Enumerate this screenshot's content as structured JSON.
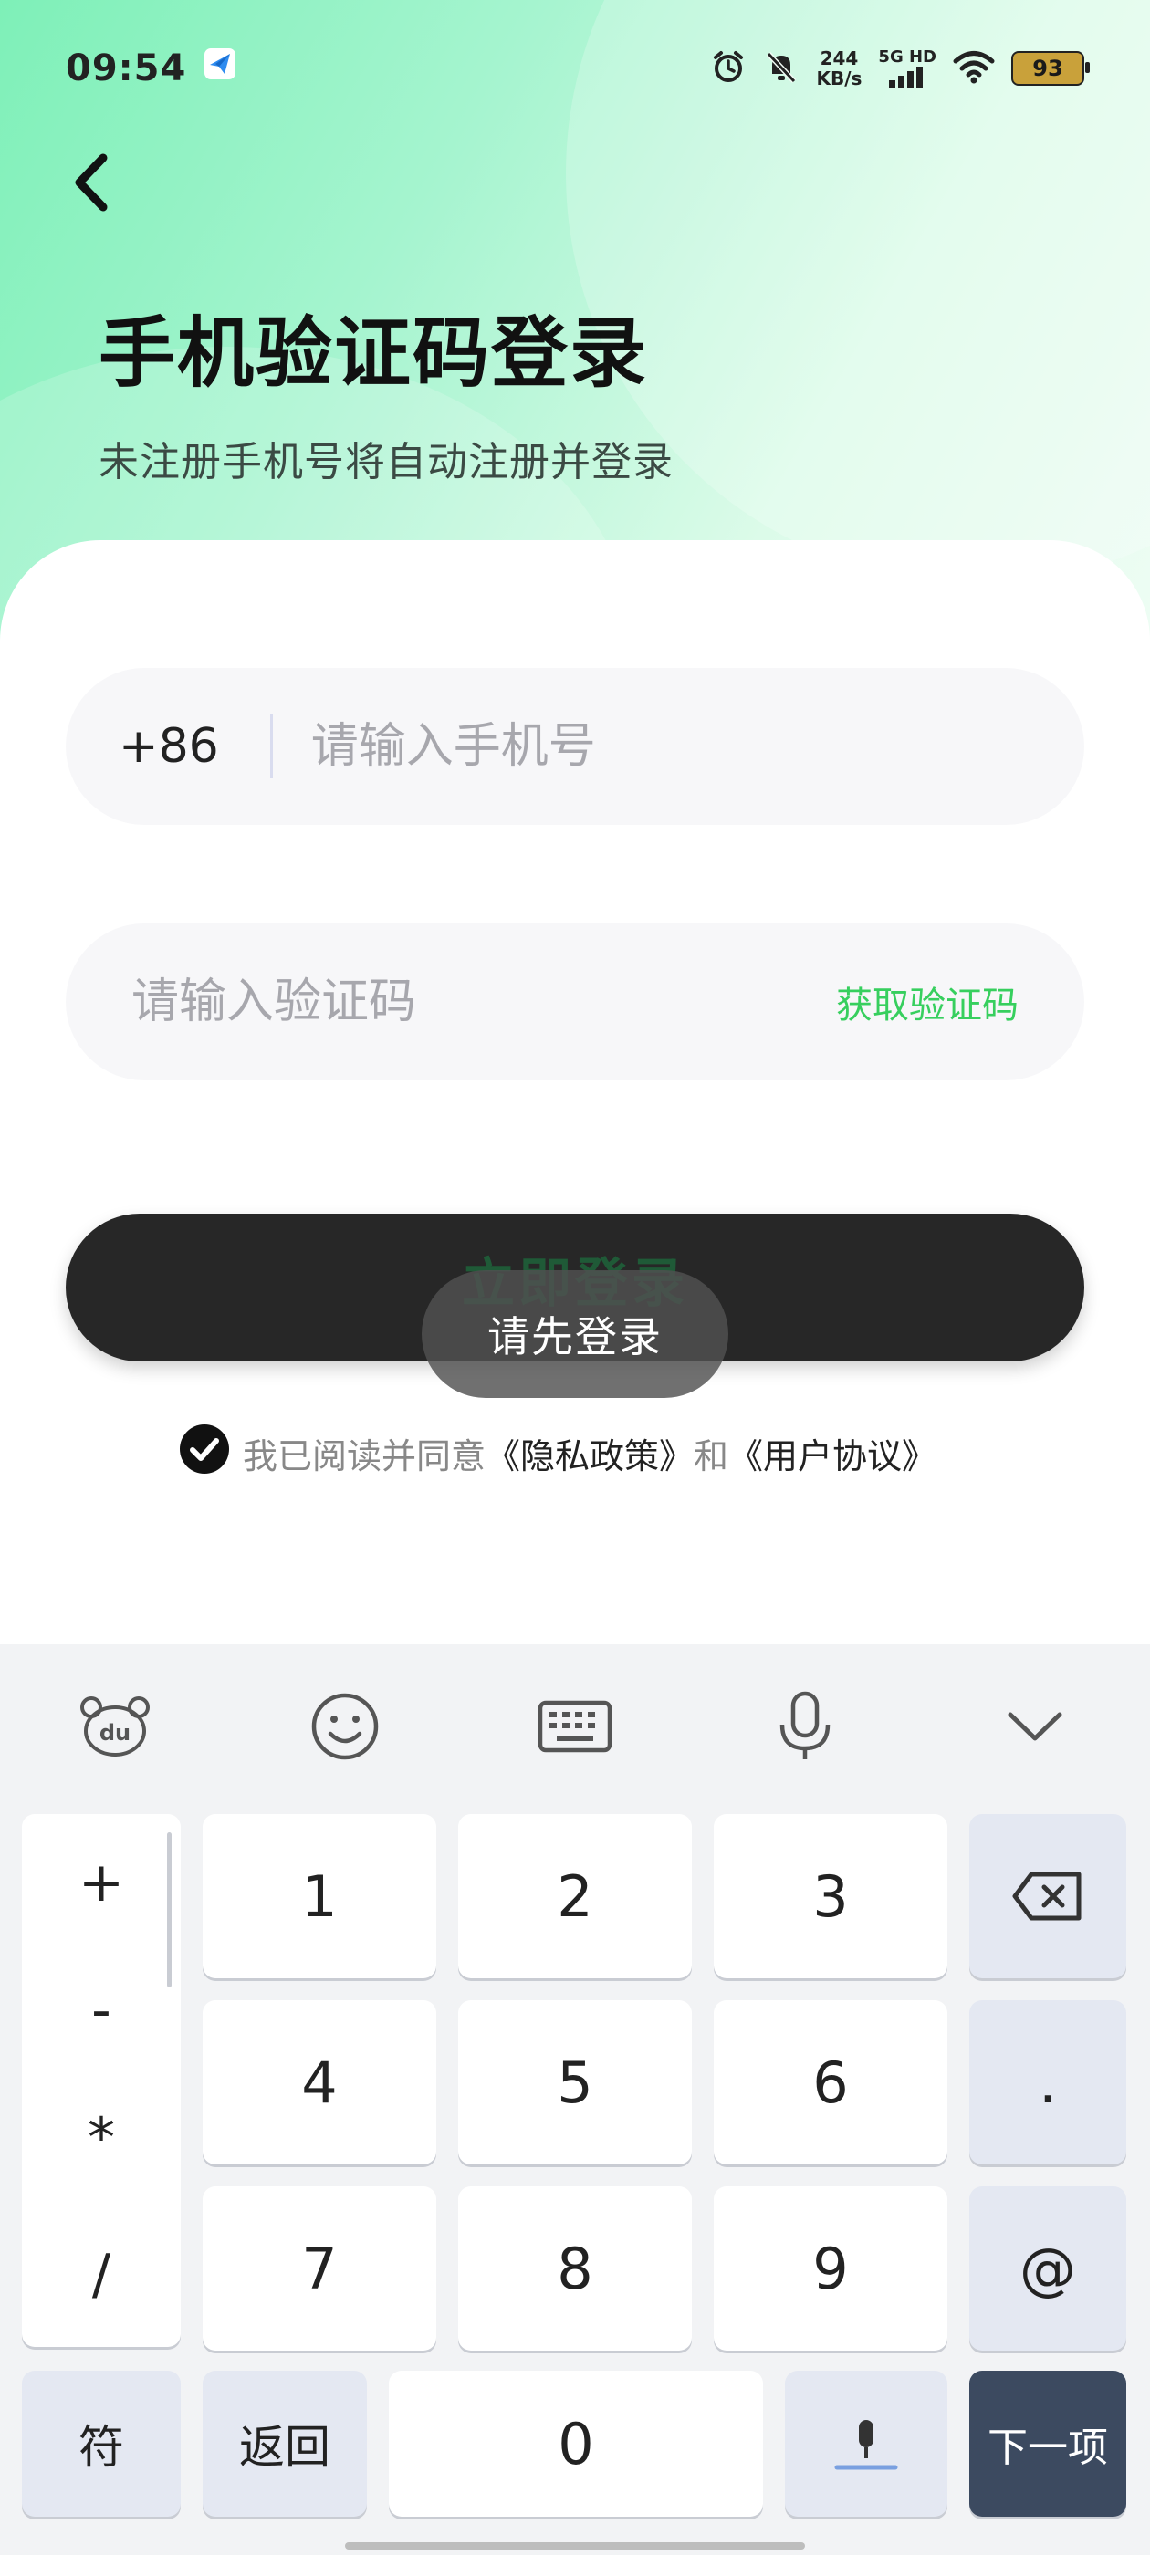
{
  "status_bar": {
    "time": "09:54",
    "net_speed_value": "244",
    "net_speed_unit": "KB/s",
    "network_label": "5G HD",
    "battery_level": "93"
  },
  "header": {
    "title": "手机验证码登录",
    "subtitle": "未注册手机号将自动注册并登录"
  },
  "form": {
    "country_code": "+86",
    "phone_placeholder": "请输入手机号",
    "code_placeholder": "请输入验证码",
    "get_code_label": "获取验证码",
    "login_label": "立即登录"
  },
  "toast": {
    "text": "请先登录"
  },
  "agreement": {
    "prefix": "我已阅读并同意",
    "privacy_link": "《隐私政策》",
    "and": "和",
    "terms_link": "《用户协议》",
    "checked": true
  },
  "keyboard": {
    "symbols": [
      "+",
      "-",
      "*",
      "/"
    ],
    "digits": [
      "1",
      "2",
      "3",
      "4",
      "5",
      "6",
      "7",
      "8",
      "9",
      "0"
    ],
    "dot": ".",
    "at": "@",
    "fu": "符",
    "back": "返回",
    "next": "下一项"
  },
  "colors": {
    "accent_green": "#37cf5e",
    "button_dark": "#272727",
    "next_key": "#3c4a60"
  }
}
